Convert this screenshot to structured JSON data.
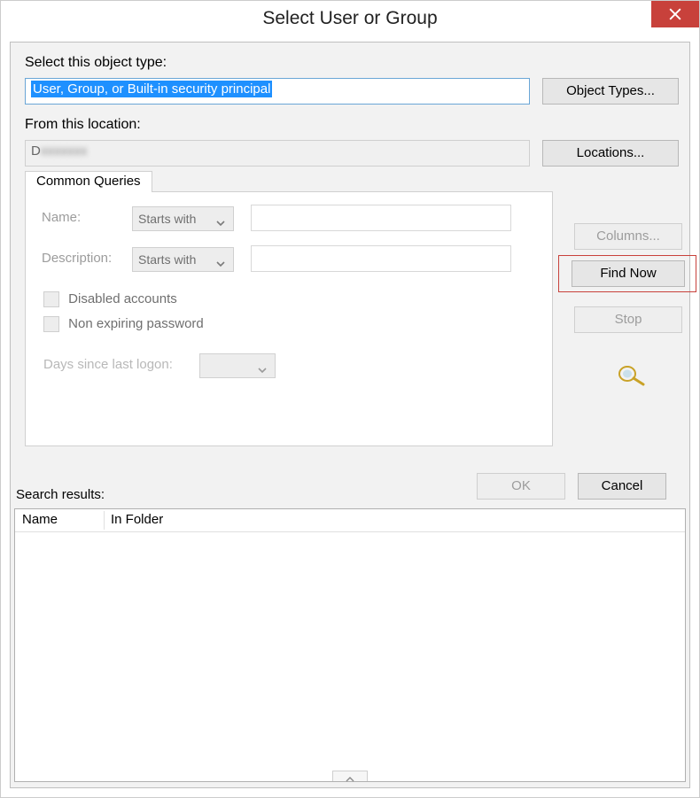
{
  "title": "Select User or Group",
  "object_type": {
    "label": "Select this object type:",
    "value": "User, Group, or Built-in security principal",
    "button": "Object Types..."
  },
  "location": {
    "label": "From this location:",
    "value": "D",
    "button": "Locations..."
  },
  "common_queries": {
    "tab_label": "Common Queries",
    "name_label": "Name:",
    "name_match": "Starts with",
    "name_value": "",
    "description_label": "Description:",
    "description_match": "Starts with",
    "description_value": "",
    "disabled_accounts_label": "Disabled accounts",
    "disabled_accounts_checked": false,
    "non_expiring_label": "Non expiring password",
    "non_expiring_checked": false,
    "days_since_label": "Days since last logon:",
    "days_since_value": ""
  },
  "side_buttons": {
    "columns": "Columns...",
    "find_now": "Find Now",
    "stop": "Stop"
  },
  "footer_buttons": {
    "ok": "OK",
    "cancel": "Cancel"
  },
  "search_results": {
    "label": "Search results:",
    "columns": {
      "name": "Name",
      "in_folder": "In Folder"
    },
    "rows": []
  }
}
